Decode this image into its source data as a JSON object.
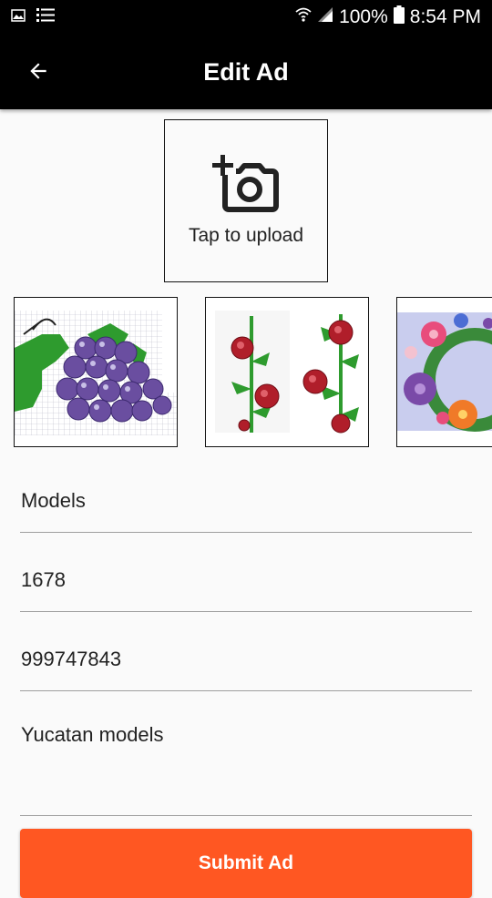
{
  "status_bar": {
    "battery": "100%",
    "time": "8:54 PM",
    "left_icons": [
      "image-icon",
      "list-icon"
    ],
    "right_icons": [
      "wifi-icon",
      "signal-icon",
      "battery-icon"
    ]
  },
  "app_bar": {
    "title": "Edit Ad",
    "back_icon": "arrow-back-icon"
  },
  "upload": {
    "label": "Tap to upload",
    "icon": "add-a-photo-icon"
  },
  "thumbnails": [
    {
      "name": "grape-cross-stitch-pattern"
    },
    {
      "name": "red-rose-border-pattern"
    },
    {
      "name": "flower-wreath-pattern"
    }
  ],
  "form": {
    "title_value": "Models",
    "price_value": "1678",
    "phone_value": "999747843",
    "description_value": "Yucatan models"
  },
  "submit_label": "Submit Ad",
  "colors": {
    "app_bar": "#000000",
    "submit": "#ff5722",
    "background": "#fafafa"
  }
}
